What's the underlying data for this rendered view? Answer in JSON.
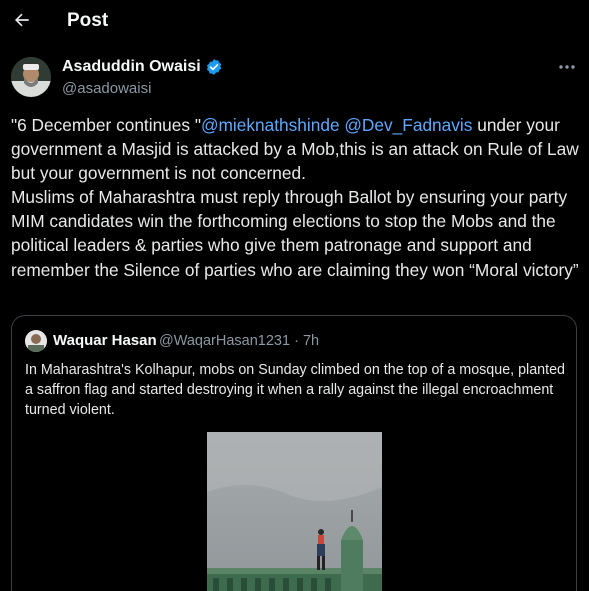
{
  "header": {
    "title": "Post"
  },
  "tweet": {
    "author_name": "Asaduddin Owaisi",
    "author_handle": "@asadowaisi",
    "text_part1": "\"6 December continues \"",
    "mention1": "@mieknathshinde",
    "text_part2": " ",
    "mention2": "@Dev_Fadnavis",
    "text_part3": " under your government a Masjid is attacked by a Mob,this is an attack on Rule of Law but your government is not concerned.\nMuslims of Maharashtra must reply through Ballot by ensuring your party MIM candidates win the forthcoming elections to stop the Mobs and the political leaders & parties who give them patronage and support and remember the Silence of parties who are claiming they won “Moral victory”"
  },
  "quote": {
    "author_name": "Waquar Hasan",
    "meta": "@WaqarHasan1231 · 7h",
    "text": "In Maharashtra's Kolhapur, mobs on Sunday climbed on the top of a mosque, planted a saffron flag and started destroying it when a rally against the illegal encroachment turned violent."
  },
  "icons": {
    "back": "arrow-left-icon",
    "verified": "verified-badge-icon",
    "more": "more-horizontal-icon"
  },
  "colors": {
    "background": "#000000",
    "text": "#e7e9ea",
    "secondary_text": "#8b98a5",
    "mention": "#5ea8ff",
    "verified": "#1d9bf0",
    "border": "#3a3f44"
  }
}
